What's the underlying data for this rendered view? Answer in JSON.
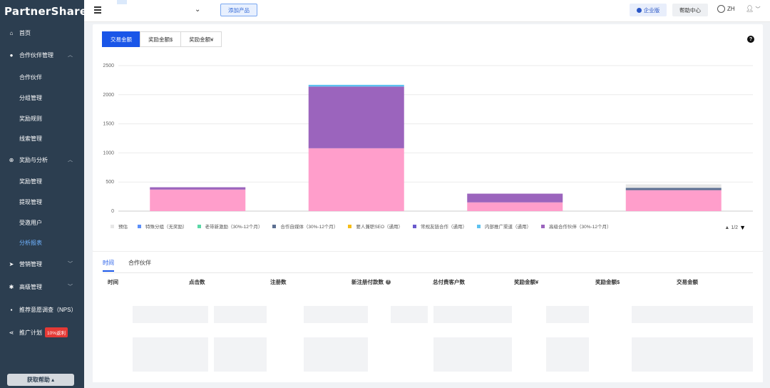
{
  "app": {
    "logo": "PartnerShare"
  },
  "sidebar": {
    "items": [
      {
        "label": "首页",
        "icon": "home-icon"
      },
      {
        "label": "合作伙伴管理",
        "icon": "user-icon"
      },
      {
        "label": "合作伙伴"
      },
      {
        "label": "分组管理"
      },
      {
        "label": "奖励规则"
      },
      {
        "label": "线索管理"
      },
      {
        "label": "奖励与分析",
        "icon": "plus-circle-icon"
      },
      {
        "label": "奖励管理"
      },
      {
        "label": "提现管理"
      },
      {
        "label": "受邀用户"
      },
      {
        "label": "分析报表"
      },
      {
        "label": "营销管理",
        "icon": "paper-plane-icon"
      },
      {
        "label": "高级管理",
        "icon": "gear-icon"
      },
      {
        "label": "推荐意愿调查（NPS）",
        "icon": "chat-icon"
      },
      {
        "label": "推广计划",
        "icon": "share-icon",
        "badge": "10%返利"
      }
    ],
    "help_button": "获取帮助 ▴"
  },
  "topbar": {
    "add_product": "添加产品",
    "enterprise": "企业版",
    "help_center": "帮助中心",
    "language": "ZH"
  },
  "tabs": [
    "交易金额",
    "奖励金额$",
    "奖励金额¥"
  ],
  "chart_data": {
    "type": "bar",
    "stacked": true,
    "ylim": [
      0,
      2500
    ],
    "yticks": [
      0,
      500,
      1000,
      1500,
      2000,
      2500
    ],
    "grid": true,
    "categories": [
      "",
      "",
      "",
      ""
    ],
    "series": [
      {
        "name": "预估",
        "color": "#e6e6e6",
        "values": [
          0,
          0,
          0,
          60
        ]
      },
      {
        "name": "特殊分组（无奖励）",
        "color": "#5b8ff9",
        "values": [
          0,
          0,
          0,
          0
        ]
      },
      {
        "name": "老带新激励（30%-12个月）",
        "color": "#5ad8a6",
        "values": [
          0,
          0,
          0,
          0
        ]
      },
      {
        "name": "合作自媒体（30%-12个月）",
        "color": "#5d7092",
        "values": [
          0,
          0,
          0,
          40
        ]
      },
      {
        "name": "要人兼职SEO（通用）",
        "color": "#f6bd16",
        "values": [
          0,
          0,
          0,
          0
        ]
      },
      {
        "name": "常规友链合作（通用）",
        "color": "#6a5acd",
        "values": [
          0,
          0,
          0,
          0
        ]
      },
      {
        "name": "内部推广渠道（通用）",
        "color": "#5ec2f0",
        "values": [
          0,
          30,
          0,
          0
        ]
      },
      {
        "name": "高级合作伙伴（30%-12个月）",
        "color": "#9b64bd",
        "values": [
          40,
          1060,
          150,
          0
        ]
      },
      {
        "name": "",
        "color": "#ff9ecb",
        "values": [
          370,
          1080,
          150,
          360
        ]
      }
    ],
    "legend_position": "bottom",
    "legend_page": "1/2"
  },
  "bottom": {
    "tabs": [
      "时间",
      "合作伙伴"
    ],
    "columns": [
      "时间",
      "点击数",
      "注册数",
      "新注册付款数",
      "总付费客户数",
      "奖励金额¥",
      "奖励金额$",
      "交易金额"
    ]
  }
}
